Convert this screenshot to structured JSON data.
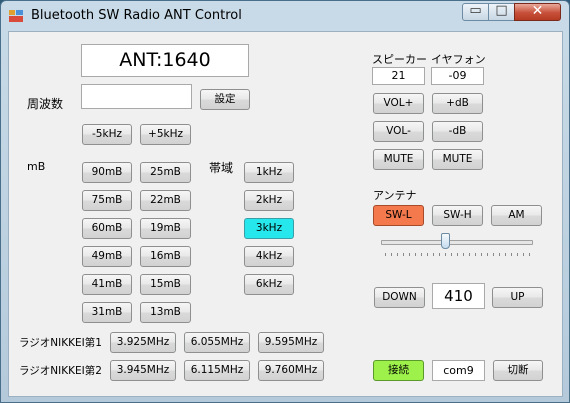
{
  "window": {
    "title": "Bluetooth SW Radio ANT Control",
    "min_label": "▭",
    "max_label": "□",
    "close_label": "✕"
  },
  "ant_display": "ANT:1640",
  "freq": {
    "label": "周波数",
    "value": "",
    "set_label": "設定"
  },
  "step": {
    "down_label": "-5kHz",
    "up_label": "+5kHz"
  },
  "band": {
    "label": "mB",
    "col1": [
      "90mB",
      "75mB",
      "60mB",
      "49mB",
      "41mB",
      "31mB"
    ],
    "col2": [
      "25mB",
      "22mB",
      "19mB",
      "16mB",
      "15mB",
      "13mB"
    ]
  },
  "bandwidth": {
    "label": "帯域",
    "items": [
      "1kHz",
      "2kHz",
      "3kHz",
      "4kHz",
      "6kHz"
    ],
    "active": "3kHz",
    "active_color": "#26e8ec"
  },
  "presets": [
    {
      "label": "ラジオNIKKEI第1",
      "freqs": [
        "3.925MHz",
        "6.055MHz",
        "9.595MHz"
      ]
    },
    {
      "label": "ラジオNIKKEI第2",
      "freqs": [
        "3.945MHz",
        "6.115MHz",
        "9.760MHz"
      ]
    }
  ],
  "audio": {
    "speaker_label": "スピーカー",
    "earphone_label": "イヤフォン",
    "speaker_value": "21",
    "earphone_value": "-09",
    "vol_up": "VOL+",
    "vol_down": "VOL-",
    "db_up": "+dB",
    "db_down": "-dB",
    "mute1": "MUTE",
    "mute2": "MUTE"
  },
  "antenna": {
    "label": "アンテナ",
    "options": [
      "SW-L",
      "SW-H",
      "AM"
    ],
    "active": "SW-L",
    "active_color": "#f47a4e",
    "slider_level": 0.42
  },
  "tune": {
    "down_label": "DOWN",
    "value": "410",
    "up_label": "UP"
  },
  "connection": {
    "connect_label": "接続",
    "connect_color": "#9df14a",
    "port": "com9",
    "disconnect_label": "切断"
  }
}
